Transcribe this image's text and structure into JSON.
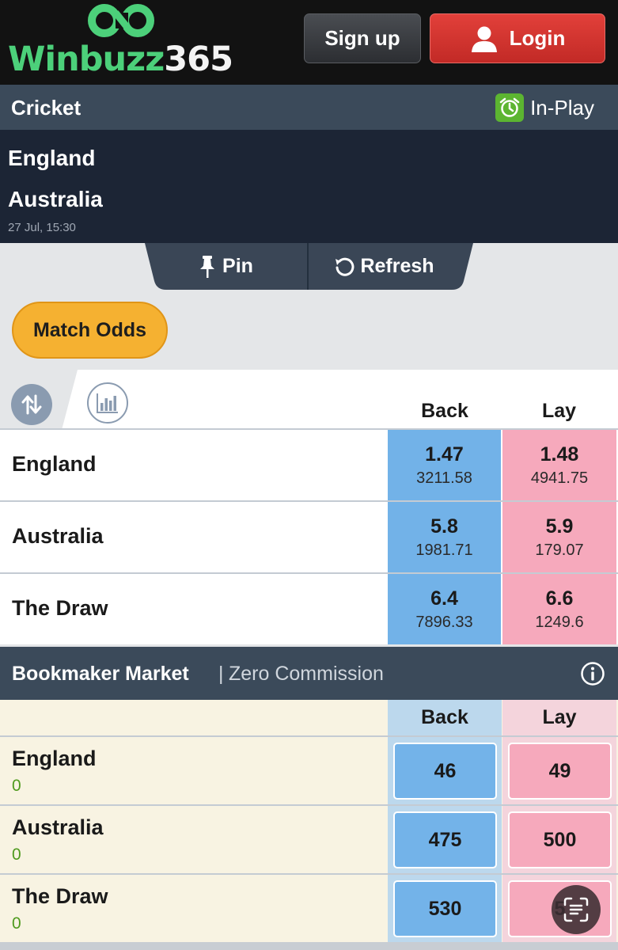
{
  "header": {
    "logo_primary": "Winbuzz",
    "logo_number": "365",
    "signup_label": "Sign up",
    "login_label": "Login"
  },
  "sport": {
    "title": "Cricket",
    "status_label": "In-Play"
  },
  "match": {
    "team1": "England",
    "team2": "Australia",
    "datetime": "27 Jul, 15:30"
  },
  "tools": {
    "pin_label": "Pin",
    "refresh_label": "Refresh"
  },
  "market_tab": {
    "label": "Match Odds"
  },
  "match_odds": {
    "back_header": "Back",
    "lay_header": "Lay",
    "rows": [
      {
        "runner": "England",
        "back_price": "1.47",
        "back_size": "3211.58",
        "lay_price": "1.48",
        "lay_size": "4941.75"
      },
      {
        "runner": "Australia",
        "back_price": "5.8",
        "back_size": "1981.71",
        "lay_price": "5.9",
        "lay_size": "179.07"
      },
      {
        "runner": "The Draw",
        "back_price": "6.4",
        "back_size": "7896.33",
        "lay_price": "6.6",
        "lay_size": "1249.6"
      }
    ]
  },
  "bookmaker": {
    "title": "Bookmaker Market",
    "separator": "|",
    "subtitle": "Zero Commission",
    "back_header": "Back",
    "lay_header": "Lay",
    "rows": [
      {
        "runner": "England",
        "pl": "0",
        "back": "46",
        "lay": "49"
      },
      {
        "runner": "Australia",
        "pl": "0",
        "back": "475",
        "lay": "500"
      },
      {
        "runner": "The Draw",
        "pl": "0",
        "back": "530",
        "lay": "5"
      }
    ]
  },
  "colors": {
    "topbar": "#121212",
    "logo_green": "#4cd07a",
    "login_red": "#d6342f",
    "sport_bar": "#3b4a5a",
    "match_bg": "#1c2535",
    "pill_orange": "#f5b131",
    "back_blue": "#72b2e8",
    "lay_pink": "#f6a9bc",
    "bookmaker_bg": "#f8f3e2",
    "pl_green": "#4f9a1e"
  },
  "icons": {
    "logo": "infinity-logo-icon",
    "login": "user-icon",
    "inplay": "alarm-clock-icon",
    "pin": "pushpin-icon",
    "refresh": "refresh-icon",
    "sort": "sort-arrows-icon",
    "chart": "bar-chart-icon",
    "info": "info-icon",
    "scan": "text-scan-icon"
  }
}
